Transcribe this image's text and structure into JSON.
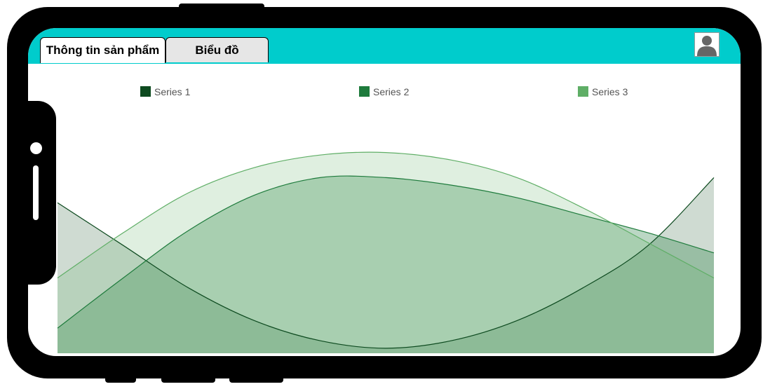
{
  "tabs": [
    {
      "label": "Thông tin sản phẩm",
      "active": true
    },
    {
      "label": "Biểu đồ",
      "active": false
    }
  ],
  "header": {
    "color": "#00cccc",
    "avatar_icon": "user-avatar-icon"
  },
  "chart_data": {
    "type": "area",
    "legend_position": "top",
    "x": [
      0,
      1,
      2,
      3,
      4,
      5,
      6,
      7,
      8,
      9,
      10
    ],
    "series": [
      {
        "name": "Series 1",
        "color": "#0d4a1f",
        "values": [
          60,
          43,
          26,
          13,
          5,
          2,
          5,
          13,
          26,
          43,
          70
        ]
      },
      {
        "name": "Series 2",
        "color": "#1e7b3c",
        "values": [
          10,
          30,
          49,
          63,
          70,
          70,
          67,
          62,
          55,
          48,
          40
        ]
      },
      {
        "name": "Series 3",
        "color": "#5fae66",
        "values": [
          30,
          48,
          64,
          74,
          79,
          80,
          77,
          70,
          58,
          44,
          30
        ]
      }
    ],
    "ylim": [
      0,
      100
    ],
    "grid": false
  }
}
